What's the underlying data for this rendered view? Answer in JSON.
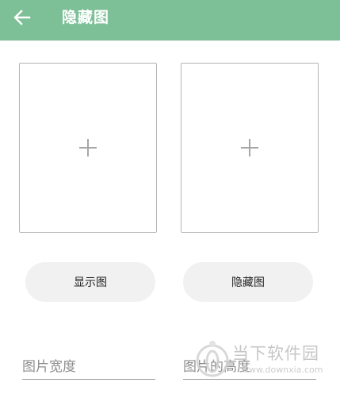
{
  "appbar": {
    "title": "隐藏图",
    "back_icon": "arrow-left-icon",
    "color": "#7dbf97"
  },
  "pickers": [
    {
      "icon": "plus-icon"
    },
    {
      "icon": "plus-icon"
    }
  ],
  "buttons": {
    "show_label": "显示图",
    "hide_label": "隐藏图"
  },
  "inputs": {
    "width_placeholder": "图片宽度",
    "height_placeholder": "图片的高度"
  },
  "watermark": {
    "name": "当下软件园",
    "url": "www.downxia.com"
  }
}
